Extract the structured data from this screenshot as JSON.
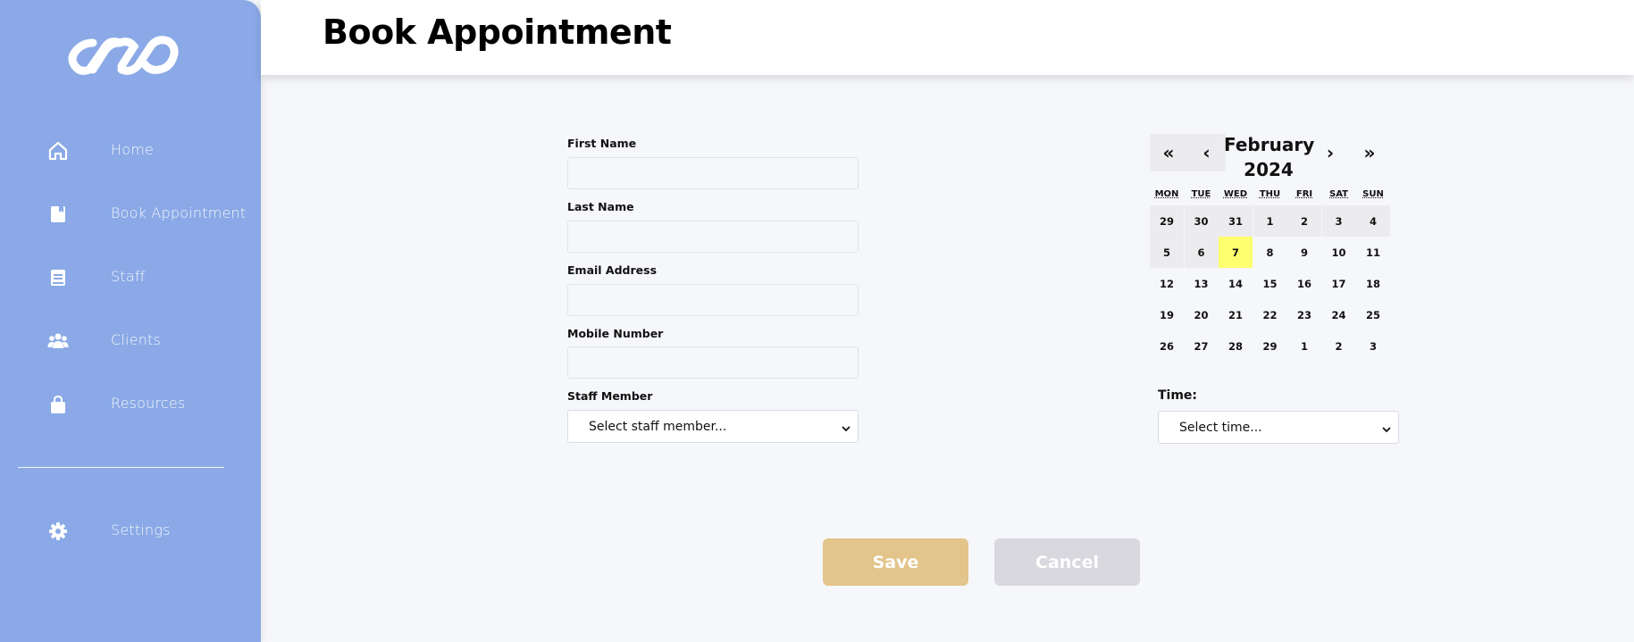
{
  "header": {
    "title": "Book Appointment"
  },
  "sidebar": {
    "items": [
      {
        "label": "Home",
        "icon": "home-icon"
      },
      {
        "label": "Book Appointment",
        "icon": "book-appointment-icon"
      },
      {
        "label": "Staff",
        "icon": "staff-book-icon"
      },
      {
        "label": "Clients",
        "icon": "clients-icon"
      },
      {
        "label": "Resources",
        "icon": "resources-bag-icon"
      }
    ],
    "settings": {
      "label": "Settings",
      "icon": "gear-icon"
    }
  },
  "form": {
    "first_name_label": "First Name",
    "last_name_label": "Last Name",
    "email_label": "Email Address",
    "mobile_label": "Mobile Number",
    "staff_label": "Staff Member",
    "staff_select": "Select staff member..."
  },
  "calendar": {
    "prev_year": "«",
    "prev_month": "‹",
    "next_month": "›",
    "next_year": "»",
    "month": "February",
    "year": "2024",
    "weekdays": [
      "MON",
      "TUE",
      "WED",
      "THU",
      "FRI",
      "SAT",
      "SUN"
    ],
    "weeks": [
      [
        "29",
        "30",
        "31",
        "1",
        "2",
        "3",
        "4"
      ],
      [
        "5",
        "6",
        "7",
        "8",
        "9",
        "10",
        "11"
      ],
      [
        "12",
        "13",
        "14",
        "15",
        "16",
        "17",
        "18"
      ],
      [
        "19",
        "20",
        "21",
        "22",
        "23",
        "24",
        "25"
      ],
      [
        "26",
        "27",
        "28",
        "29",
        "1",
        "2",
        "3"
      ]
    ],
    "selected_day": "7"
  },
  "time": {
    "label": "Time:",
    "select": "Select time..."
  },
  "buttons": {
    "save": "Save",
    "cancel": "Cancel"
  },
  "colors": {
    "sidebar": "#8aa9e6",
    "save": "#e3c48a",
    "cancel": "#d8d8de",
    "today_highlight": "#fdff6e"
  }
}
